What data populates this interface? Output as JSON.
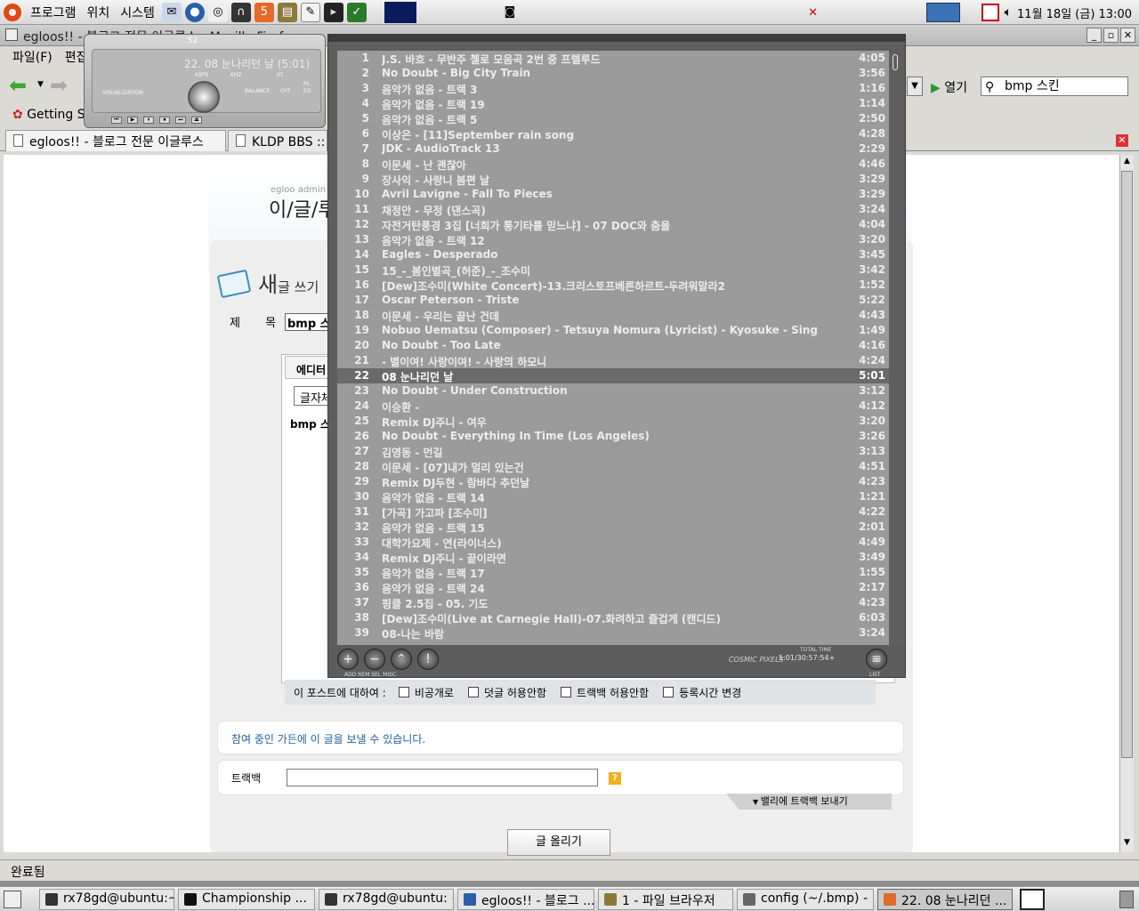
{
  "top_panel": {
    "menus": [
      "프로그램",
      "위치",
      "시스템"
    ],
    "clock": "11월 18일 (금) 13:00"
  },
  "firefox": {
    "title": "egloos!! - 블로그 전문 이글루스 - Mozilla Firefox",
    "menubar": [
      "파일(F)",
      "편집"
    ],
    "go_label": "열기",
    "search_value": "bmp 스킨",
    "bookmark": "Getting Started",
    "tabs": [
      "egloos!! - 블로그 전문 이글루스",
      "KLDP BBS :: 검"
    ],
    "status": "완료됨"
  },
  "page": {
    "brand_small": "egloo admin",
    "brand_big": "이/글/루",
    "write_title_big": "새",
    "write_title_small": "글 쓰기",
    "subject_label": "제 목",
    "subject_value": "bmp 스킨",
    "editor_tab": "에디터",
    "font_select": "글자체",
    "editor_body": "bmp 스킨",
    "options_label": "이 포스트에 대하여 :",
    "options": [
      "비공개로",
      "덧글 허용안함",
      "트랙백 허용안함",
      "등록시간 변경"
    ],
    "group_text": "참여 중인 가든에 이 글을 보낼 수 있습니다.",
    "trackback_label": "트랙백",
    "trackback_help": "?",
    "send_trackback": "밸리에 트랙백 보내기",
    "submit": "글 올리기"
  },
  "bmp": {
    "main_title": "S2",
    "current_track": "22. 08 눈나리던 날 (5:01)",
    "mini_labels": [
      "KBPS",
      "KHZ",
      "VISUALIZATION",
      "BALANCE",
      "ST",
      "OFF",
      "PL",
      "EQ"
    ],
    "controls": [
      "⏮",
      "▶",
      "⏸",
      "⏹",
      "⏭",
      "⏏"
    ],
    "playlist": [
      {
        "n": "1",
        "title": "J.S. 바흐 - 무반주 첼로 모음곡 2번 중 프렐루드",
        "time": "4:05"
      },
      {
        "n": "2",
        "title": "No Doubt - Big City Train",
        "time": "3:56"
      },
      {
        "n": "3",
        "title": "음악가 없음 - 트랙 3",
        "time": "1:16"
      },
      {
        "n": "4",
        "title": "음악가 없음 - 트랙 19",
        "time": "1:14"
      },
      {
        "n": "5",
        "title": "음악가 없음 - 트랙 5",
        "time": "2:50"
      },
      {
        "n": "6",
        "title": "이상은 - [11]September rain song",
        "time": "4:28"
      },
      {
        "n": "7",
        "title": "JDK - AudioTrack 13",
        "time": "2:29"
      },
      {
        "n": "8",
        "title": "이문세 - 난 괜찮아",
        "time": "4:46"
      },
      {
        "n": "9",
        "title": "장사익 - 사랑니 봄편 날",
        "time": "3:29"
      },
      {
        "n": "10",
        "title": "Avril Lavigne - Fall To Pieces",
        "time": "3:29"
      },
      {
        "n": "11",
        "title": "채정안 - 무정 (댄스곡)",
        "time": "3:24"
      },
      {
        "n": "12",
        "title": "자전거탄풍경 3집 [너희가 통기타를 믿느냐] - 07 DOC와 춤을",
        "time": "4:04"
      },
      {
        "n": "13",
        "title": "음악가 없음 - 트랙 12",
        "time": "3:20"
      },
      {
        "n": "14",
        "title": "Eagles - Desperado",
        "time": "3:45"
      },
      {
        "n": "15",
        "title": "15_-_봄인별곡_(허준)_-_조수미",
        "time": "3:42"
      },
      {
        "n": "16",
        "title": "[Dew]조수미(White Concert)-13.크리스토프베른하르트-두려워말라2",
        "time": "1:52"
      },
      {
        "n": "17",
        "title": "Oscar Peterson - Triste",
        "time": "5:22"
      },
      {
        "n": "18",
        "title": "이문세 - 우리는 끝난 건데",
        "time": "4:43"
      },
      {
        "n": "19",
        "title": "Nobuo Uematsu (Composer) - Tetsuya Nomura (Lyricist) - Kyosuke  - Sing",
        "time": "1:49"
      },
      {
        "n": "20",
        "title": "No Doubt - Too Late",
        "time": "4:16"
      },
      {
        "n": "21",
        "title": "- 별이여! 사랑이여! - 사랑의 하모니",
        "time": "4:24"
      },
      {
        "n": "22",
        "title": "08 눈나리던 날",
        "time": "5:01"
      },
      {
        "n": "23",
        "title": "No Doubt - Under Construction",
        "time": "3:12"
      },
      {
        "n": "24",
        "title": "이승환 -",
        "time": "4:12"
      },
      {
        "n": "25",
        "title": "Remix DJ주니 - 여우",
        "time": "3:20"
      },
      {
        "n": "26",
        "title": "No Doubt - Everything In Time (Los Angeles)",
        "time": "3:26"
      },
      {
        "n": "27",
        "title": "김영동 - 먼길",
        "time": "3:13"
      },
      {
        "n": "28",
        "title": "이문세 - [07]내가 멀리 있는건",
        "time": "4:51"
      },
      {
        "n": "29",
        "title": "Remix DJ두현 - 람바다 추던날",
        "time": "4:23"
      },
      {
        "n": "30",
        "title": "음악가 없음 - 트랙 14",
        "time": "1:21"
      },
      {
        "n": "31",
        "title": "[가곡] 가고파 [조수미]",
        "time": "4:22"
      },
      {
        "n": "32",
        "title": "음악가 없음 - 트랙 15",
        "time": "2:01"
      },
      {
        "n": "33",
        "title": "대학가요제 - 연(라이너스)",
        "time": "4:49"
      },
      {
        "n": "34",
        "title": "Remix DJ주니 - 끝이라면",
        "time": "3:49"
      },
      {
        "n": "35",
        "title": "음악가 없음 - 트랙 17",
        "time": "1:55"
      },
      {
        "n": "36",
        "title": "음악가 없음 - 트랙 24",
        "time": "2:17"
      },
      {
        "n": "37",
        "title": "핑클 2.5집 - 05. 기도",
        "time": "4:23"
      },
      {
        "n": "38",
        "title": "[Dew]조수미(Live at Carnegie Hall)-07.화려하고 즐겁게 (캔디드)",
        "time": "6:03"
      },
      {
        "n": "39",
        "title": "08-나는 바람",
        "time": "3:24"
      }
    ],
    "current_index": 21,
    "pl_buttons": [
      "+",
      "−",
      "⌃",
      "!"
    ],
    "pl_menu_labels": "ADD   REM   SEL   MISC",
    "pl_list_label": "LIST",
    "total_time_label": "TOTAL TIME",
    "total_time": "5:01/30:57:54+",
    "brand": "COSMIC PIXELS"
  },
  "taskbar": [
    {
      "label": "rx78gd@ubuntu:~",
      "icon_color": "#333333"
    },
    {
      "label": "Championship ...",
      "icon_color": "#111111"
    },
    {
      "label": "rx78gd@ubuntu: ~",
      "icon_color": "#333333"
    },
    {
      "label": "egloos!! - 블로그 ...",
      "icon_color": "#2a5fa8"
    },
    {
      "label": "1 - 파일 브라우저",
      "icon_color": "#8a7a3a"
    },
    {
      "label": "config (~/.bmp) - ...",
      "icon_color": "#666666"
    },
    {
      "label": "22. 08 눈나리던 ...",
      "icon_color": "#e06a2a"
    }
  ]
}
